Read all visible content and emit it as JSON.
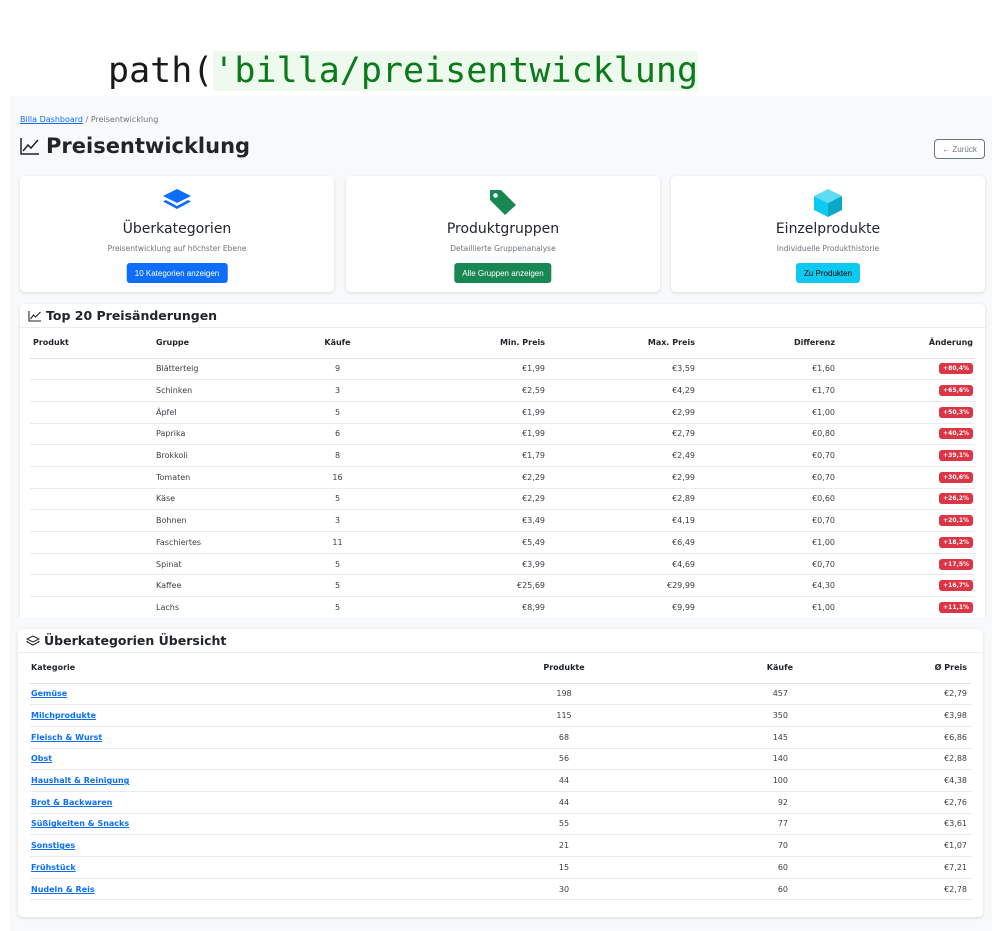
{
  "code_path": {
    "prefix": "path(",
    "route": "'billa/preisentwicklung"
  },
  "breadcrumb": {
    "home": "Billa Dashboard",
    "separator": "/",
    "current": "Preisentwicklung"
  },
  "page": {
    "title": "Preisentwicklung",
    "back_label": "← Zurück"
  },
  "cards": [
    {
      "title": "Überkategorien",
      "subtitle": "Preisentwicklung auf höchster Ebene",
      "button": "10 Kategorien anzeigen",
      "color": "#0d6efd",
      "icon": "layers-icon"
    },
    {
      "title": "Produktgruppen",
      "subtitle": "Detaillierte Gruppenanalyse",
      "button": "Alle Gruppen anzeigen",
      "color": "#198754",
      "icon": "tags-icon"
    },
    {
      "title": "Einzelprodukte",
      "subtitle": "Individuelle Produkthistorie",
      "button": "Zu Produkten",
      "color": "#0dcaf0",
      "icon": "box-icon"
    }
  ],
  "top_changes": {
    "title": "Top 20 Preisänderungen",
    "headers": [
      "Produkt",
      "Gruppe",
      "Käufe",
      "Min. Preis",
      "Max. Preis",
      "Differenz",
      "Änderung"
    ],
    "rows": [
      {
        "produkt": "",
        "gruppe": "Blätterteig",
        "kaeufe": "9",
        "min": "€1,99",
        "max": "€3,59",
        "diff": "€1,60",
        "change": "+80,4%"
      },
      {
        "produkt": "",
        "gruppe": "Schinken",
        "kaeufe": "3",
        "min": "€2,59",
        "max": "€4,29",
        "diff": "€1,70",
        "change": "+65,6%"
      },
      {
        "produkt": "",
        "gruppe": "Äpfel",
        "kaeufe": "5",
        "min": "€1,99",
        "max": "€2,99",
        "diff": "€1,00",
        "change": "+50,3%"
      },
      {
        "produkt": "",
        "gruppe": "Paprika",
        "kaeufe": "6",
        "min": "€1,99",
        "max": "€2,79",
        "diff": "€0,80",
        "change": "+40,2%"
      },
      {
        "produkt": "",
        "gruppe": "Brokkoli",
        "kaeufe": "8",
        "min": "€1,79",
        "max": "€2,49",
        "diff": "€0,70",
        "change": "+39,1%"
      },
      {
        "produkt": "",
        "gruppe": "Tomaten",
        "kaeufe": "16",
        "min": "€2,29",
        "max": "€2,99",
        "diff": "€0,70",
        "change": "+30,6%"
      },
      {
        "produkt": "",
        "gruppe": "Käse",
        "kaeufe": "5",
        "min": "€2,29",
        "max": "€2,89",
        "diff": "€0,60",
        "change": "+26,2%"
      },
      {
        "produkt": "",
        "gruppe": "Bohnen",
        "kaeufe": "3",
        "min": "€3,49",
        "max": "€4,19",
        "diff": "€0,70",
        "change": "+20,1%"
      },
      {
        "produkt": "",
        "gruppe": "Faschiertes",
        "kaeufe": "11",
        "min": "€5,49",
        "max": "€6,49",
        "diff": "€1,00",
        "change": "+18,2%"
      },
      {
        "produkt": "",
        "gruppe": "Spinat",
        "kaeufe": "5",
        "min": "€3,99",
        "max": "€4,69",
        "diff": "€0,70",
        "change": "+17,5%"
      },
      {
        "produkt": "",
        "gruppe": "Kaffee",
        "kaeufe": "5",
        "min": "€25,69",
        "max": "€29,99",
        "diff": "€4,30",
        "change": "+16,7%"
      },
      {
        "produkt": "",
        "gruppe": "Lachs",
        "kaeufe": "5",
        "min": "€8,99",
        "max": "€9,99",
        "diff": "€1,00",
        "change": "+11,1%"
      }
    ]
  },
  "overview": {
    "title": "Überkategorien Übersicht",
    "headers": [
      "Kategorie",
      "Produkte",
      "Käufe",
      "Ø Preis"
    ],
    "rows": [
      {
        "kategorie": "Gemüse",
        "produkte": "198",
        "kaeufe": "457",
        "preis": "€2,79"
      },
      {
        "kategorie": "Milchprodukte",
        "produkte": "115",
        "kaeufe": "350",
        "preis": "€3,98"
      },
      {
        "kategorie": "Fleisch & Wurst",
        "produkte": "68",
        "kaeufe": "145",
        "preis": "€6,86"
      },
      {
        "kategorie": "Obst",
        "produkte": "56",
        "kaeufe": "140",
        "preis": "€2,88"
      },
      {
        "kategorie": "Haushalt & Reinigung",
        "produkte": "44",
        "kaeufe": "100",
        "preis": "€4,38"
      },
      {
        "kategorie": "Brot & Backwaren",
        "produkte": "44",
        "kaeufe": "92",
        "preis": "€2,76"
      },
      {
        "kategorie": "Süßigkeiten & Snacks",
        "produkte": "55",
        "kaeufe": "77",
        "preis": "€3,61"
      },
      {
        "kategorie": "Sonstiges",
        "produkte": "21",
        "kaeufe": "70",
        "preis": "€1,07"
      },
      {
        "kategorie": "Frühstück",
        "produkte": "15",
        "kaeufe": "60",
        "preis": "€7,21"
      },
      {
        "kategorie": "Nudeln & Reis",
        "produkte": "30",
        "kaeufe": "60",
        "preis": "€2,78"
      }
    ]
  }
}
